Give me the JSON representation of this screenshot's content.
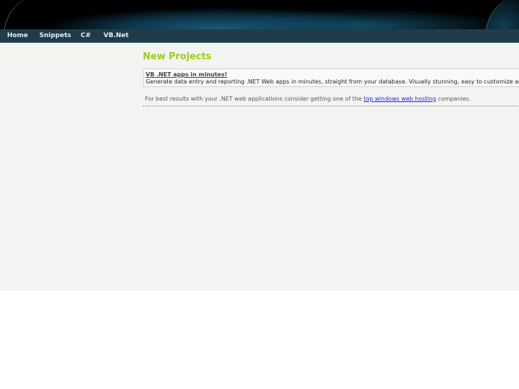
{
  "nav": {
    "items": [
      "Home",
      "Snippets",
      "C#",
      "VB.Net"
    ]
  },
  "main": {
    "title": "New Projects",
    "promo": {
      "link": "VB .NET apps in minutes!",
      "text": "Generate data entry and reporting .NET Web apps in minutes, straight from your database. Visually stunning, easy to customize and re"
    },
    "tip": {
      "before": "For best results with your .NET web applications consider getting one of the ",
      "link": "top windows web hosting",
      "after": " companies."
    }
  }
}
